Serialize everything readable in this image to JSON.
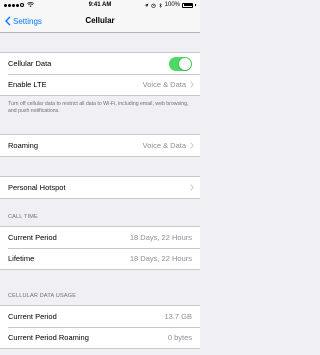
{
  "status_bar": {
    "time": "9:41 AM",
    "battery": "100%"
  },
  "nav": {
    "back_label": "Settings",
    "title": "Cellular"
  },
  "group1": {
    "cellular_data_label": "Cellular Data",
    "cellular_data_on": true,
    "enable_lte_label": "Enable LTE",
    "enable_lte_value": "Voice & Data"
  },
  "note": "Turn off cellular data to restrict all data to Wi-Fi, including email, web browsing, and push notifications.",
  "roaming": {
    "label": "Roaming",
    "value": "Voice & Data"
  },
  "hotspot": {
    "label": "Personal Hotspot"
  },
  "call_time": {
    "header": "CALL TIME",
    "rows": [
      {
        "label": "Current Period",
        "value": "18 Days, 22 Hours"
      },
      {
        "label": "Lifetime",
        "value": "18 Days, 22 Hours"
      }
    ]
  },
  "data_usage": {
    "header": "CELLULAR DATA USAGE",
    "rows": [
      {
        "label": "Current Period",
        "value": "13.7 GB"
      },
      {
        "label": "Current Period Roaming",
        "value": "0 bytes"
      }
    ]
  },
  "colors": {
    "accent": "#007aff",
    "toggle_on": "#4cd964",
    "background": "#efeff4",
    "secondary_text": "#8e8e93"
  }
}
